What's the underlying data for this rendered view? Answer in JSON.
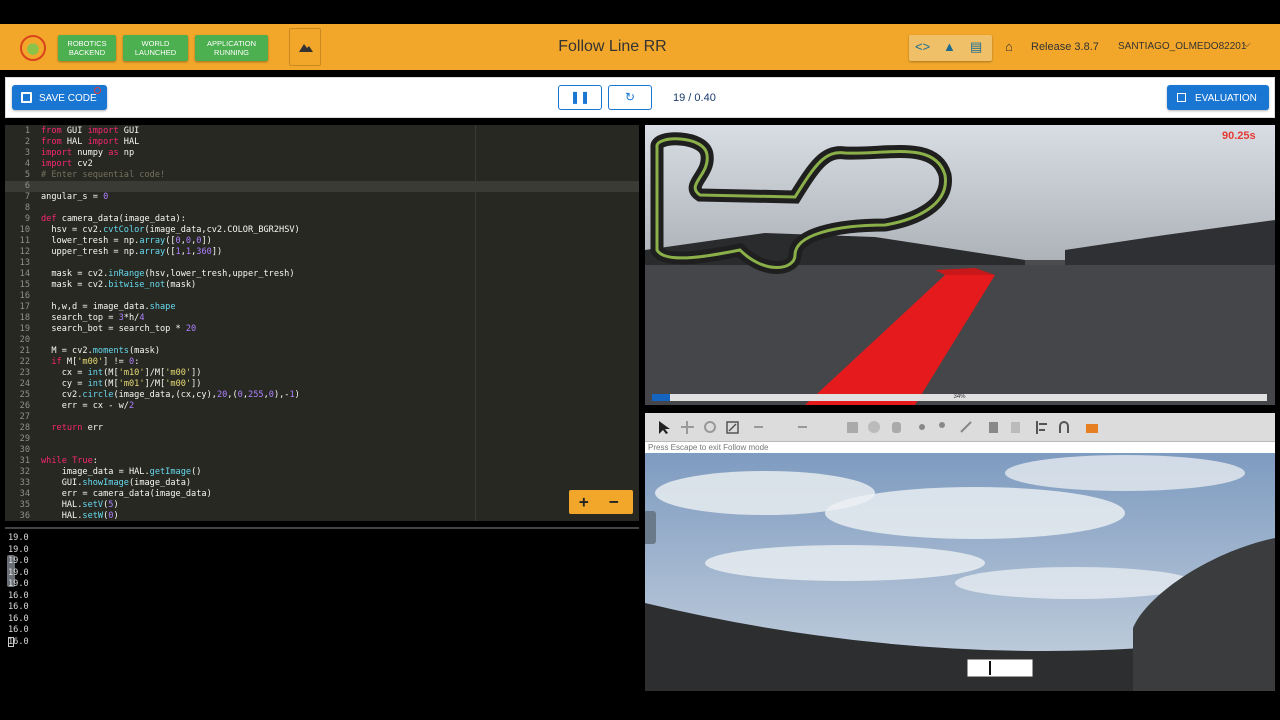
{
  "header": {
    "status_buttons": [
      {
        "line1": "ROBOTICS",
        "line2": "BACKEND"
      },
      {
        "line1": "WORLD",
        "line2": "LAUNCHED"
      },
      {
        "line1": "APPLICATION",
        "line2": "RUNNING"
      }
    ],
    "title": "Follow Line RR",
    "release": "Release 3.8.7",
    "user": "SANTIAGO_OLMEDO82201",
    "icons": [
      "code-icon",
      "school-icon",
      "chat-icon",
      "home-icon",
      "chevron-down-icon"
    ]
  },
  "toolbar": {
    "save_label": "SAVE CODE",
    "counter": "19 / 0.40",
    "evaluation_label": "EVALUATION"
  },
  "editor": {
    "lines": [
      {
        "n": "1",
        "t": "from GUI import GUI"
      },
      {
        "n": "2",
        "t": "from HAL import HAL"
      },
      {
        "n": "3",
        "t": "import numpy as np"
      },
      {
        "n": "4",
        "t": "import cv2"
      },
      {
        "n": "5",
        "t": "# Enter sequential code!"
      },
      {
        "n": "6",
        "t": ""
      },
      {
        "n": "7",
        "t": "angular_s = 0"
      },
      {
        "n": "8",
        "t": ""
      },
      {
        "n": "9",
        "t": "def camera_data(image_data):"
      },
      {
        "n": "10",
        "t": "  hsv = cv2.cvtColor(image_data,cv2.COLOR_BGR2HSV)"
      },
      {
        "n": "11",
        "t": "  lower_tresh = np.array([0,0,0])"
      },
      {
        "n": "12",
        "t": "  upper_tresh = np.array([1,1,360])"
      },
      {
        "n": "13",
        "t": ""
      },
      {
        "n": "14",
        "t": "  mask = cv2.inRange(hsv,lower_tresh,upper_tresh)"
      },
      {
        "n": "15",
        "t": "  mask = cv2.bitwise_not(mask)"
      },
      {
        "n": "16",
        "t": ""
      },
      {
        "n": "17",
        "t": "  h,w,d = image_data.shape"
      },
      {
        "n": "18",
        "t": "  search_top = 3*h/4"
      },
      {
        "n": "19",
        "t": "  search_bot = search_top * 20"
      },
      {
        "n": "20",
        "t": ""
      },
      {
        "n": "21",
        "t": "  M = cv2.moments(mask)"
      },
      {
        "n": "22",
        "t": "  if M['m00'] != 0:"
      },
      {
        "n": "23",
        "t": "    cx = int(M['m10']/M['m00'])"
      },
      {
        "n": "24",
        "t": "    cy = int(M['m01']/M['m00'])"
      },
      {
        "n": "25",
        "t": "    cv2.circle(image_data,(cx,cy),20,(0,255,0),-1)"
      },
      {
        "n": "26",
        "t": "    err = cx - w/2"
      },
      {
        "n": "27",
        "t": ""
      },
      {
        "n": "28",
        "t": "  return err"
      },
      {
        "n": "29",
        "t": ""
      },
      {
        "n": "30",
        "t": ""
      },
      {
        "n": "31",
        "t": "while True:"
      },
      {
        "n": "32",
        "t": "    image_data = HAL.getImage()"
      },
      {
        "n": "33",
        "t": "    GUI.showImage(image_data)"
      },
      {
        "n": "34",
        "t": "    err = camera_data(image_data)"
      },
      {
        "n": "35",
        "t": "    HAL.setV(5)"
      },
      {
        "n": "36",
        "t": "    HAL.setW(0)"
      }
    ],
    "active_line": 6,
    "zoom_in": "+",
    "zoom_out": "−"
  },
  "console": {
    "lines": [
      "19.0",
      "19.0",
      "19.0",
      "19.0",
      "19.0",
      "16.0",
      "16.0",
      "16.0",
      "16.0",
      "16.0"
    ]
  },
  "simulation": {
    "timer": "90.25s",
    "progress_label": "34%",
    "progress": 0.03
  },
  "gazebo": {
    "hint": "Press Escape to exit Follow mode"
  },
  "colors": {
    "header": "#f2a72a",
    "status_green": "#4caf50",
    "primary_blue": "#1976d2",
    "editor_bg": "#272822",
    "track_red": "#e41a1c"
  }
}
